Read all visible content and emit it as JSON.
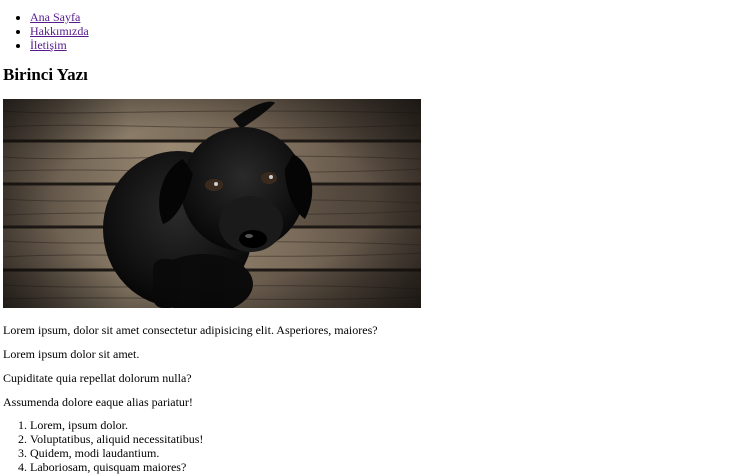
{
  "nav": {
    "items": [
      {
        "label": "Ana Sayfa"
      },
      {
        "label": "Hakkımızda"
      },
      {
        "label": "İletişim"
      }
    ],
    "link_color": "#551a8b"
  },
  "article": {
    "title": "Birinci Yazı",
    "image": {
      "subject": "black-labrador-puppy-on-wooden-floor"
    },
    "paragraphs": [
      "Lorem ipsum, dolor sit amet consectetur adipisicing elit. Asperiores, maiores?",
      "Lorem ipsum dolor sit amet.",
      "Cupiditate quia repellat dolorum nulla?",
      "Assumenda dolore eaque alias pariatur!"
    ],
    "list": [
      "Lorem, ipsum dolor.",
      "Voluptatibus, aliquid necessitatibus!",
      "Quidem, modi laudantium.",
      "Laboriosam, quisquam maiores?"
    ]
  }
}
